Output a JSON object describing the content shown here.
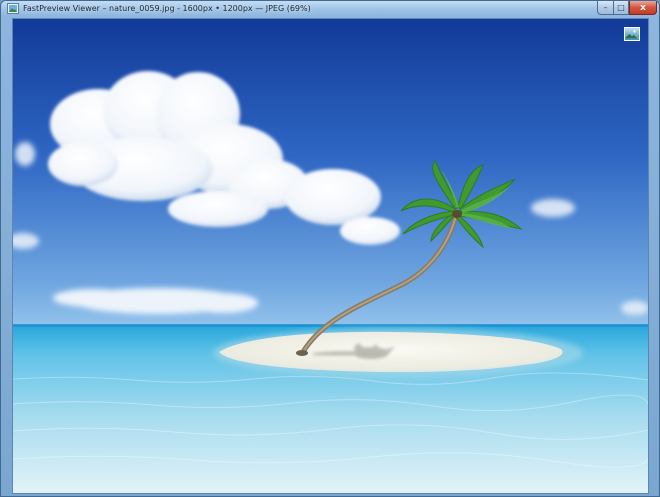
{
  "window": {
    "title": "FastPreview Viewer – nature_0059.jpg - 1600px • 1200px — JPEG (69%)",
    "controls": {
      "minimize": "–",
      "maximize": "□",
      "close": "x"
    }
  },
  "colors": {
    "sky_top": "#143f9d",
    "sky_horizon": "#7fb3e4",
    "sea_far": "#3fb0e0",
    "sea_near": "#d5eef6",
    "sand": "#f2f0e6",
    "palm_leaf": "#3a8f2a"
  },
  "icons": {
    "app": "app-picture-icon",
    "fullscreen": "picture-thumbnail-icon"
  }
}
